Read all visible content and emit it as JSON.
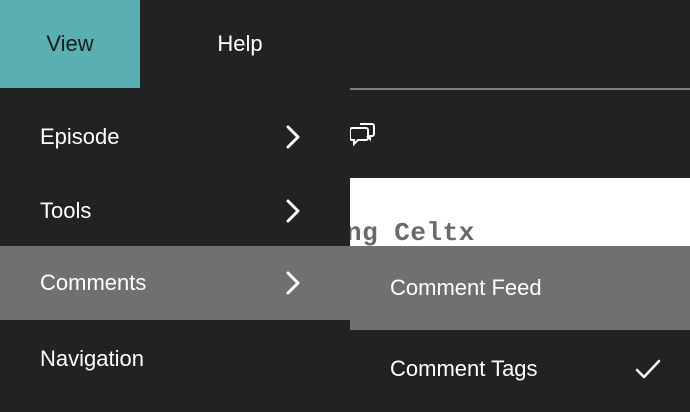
{
  "menubar": {
    "items": [
      {
        "label": "View",
        "active": true
      },
      {
        "label": "Help",
        "active": false
      }
    ],
    "accent_color": "#5aafb2"
  },
  "background": {
    "doc_text": "ng Celtx",
    "comment_button_icon": "comment-bubbles-icon"
  },
  "view_menu": {
    "items": [
      {
        "label": "Episode",
        "has_submenu": true,
        "icon": "chevron-right-icon"
      },
      {
        "label": "Tools",
        "has_submenu": true,
        "icon": "chevron-right-icon"
      },
      {
        "label": "Comments",
        "has_submenu": true,
        "icon": "chevron-right-icon",
        "highlighted": true
      },
      {
        "label": "Navigation",
        "has_submenu": false
      }
    ],
    "highlight_color": "#707070"
  },
  "comments_submenu": {
    "items": [
      {
        "label": "Comment Feed",
        "checked": false,
        "highlighted": true
      },
      {
        "label": "Comment Tags",
        "checked": true,
        "icon": "checkmark-icon"
      }
    ]
  }
}
